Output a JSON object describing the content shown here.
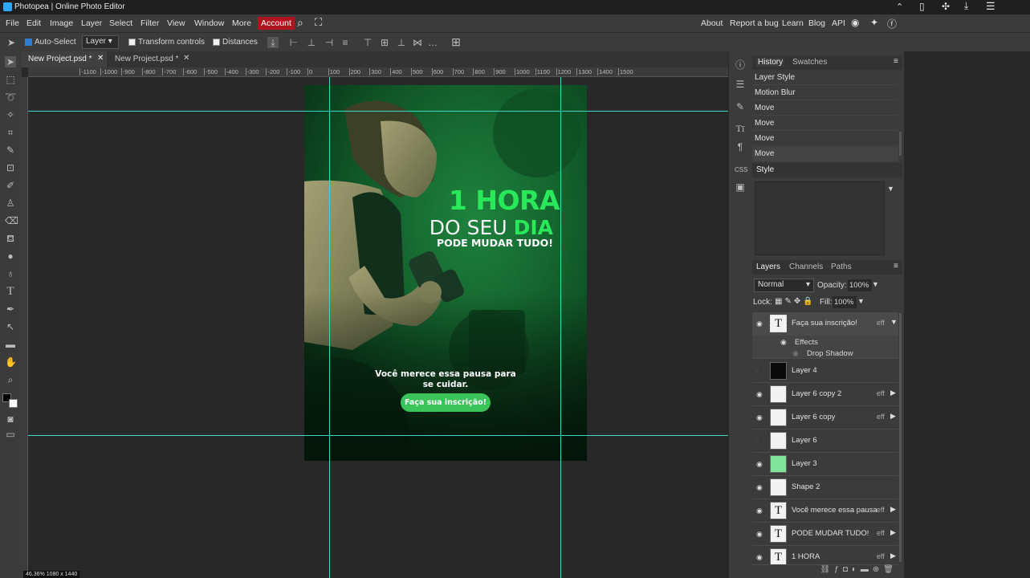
{
  "app": {
    "title": "Photopea | Online Photo Editor"
  },
  "menu": {
    "items": [
      "File",
      "Edit",
      "Image",
      "Layer",
      "Select",
      "Filter",
      "View",
      "Window",
      "More"
    ],
    "account": "Account",
    "right": [
      "About",
      "Report a bug",
      "Learn",
      "Blog",
      "API"
    ]
  },
  "options": {
    "auto_select": "Auto-Select",
    "layer_select": "Layer",
    "transform_controls": "Transform controls",
    "distances": "Distances"
  },
  "tabs": [
    {
      "label": "New Project.psd *",
      "active": true
    },
    {
      "label": "New Project.psd *",
      "active": false
    }
  ],
  "ruler": {
    "ticks": [
      "-1100",
      "-1000",
      "-900",
      "-800",
      "-700",
      "-600",
      "-500",
      "-400",
      "-300",
      "-200",
      "-100",
      "0",
      "100",
      "200",
      "300",
      "400",
      "500",
      "600",
      "700",
      "800",
      "900",
      "1000",
      "1100",
      "1200",
      "1300",
      "1400",
      "1500"
    ]
  },
  "poster": {
    "headline1": "1 HORA",
    "headline2a": "DO SEU ",
    "headline2b": "DIA",
    "headline3": "PODE MUDAR TUDO!",
    "body1": "Você merece essa pausa para",
    "body2": "se cuidar.",
    "cta": "Faça sua inscrição!",
    "accent": "#29e85a",
    "cta_color": "#3bc45a"
  },
  "history": {
    "tabs": [
      "History",
      "Swatches"
    ],
    "items": [
      "Layer Style",
      "Motion Blur",
      "Move",
      "Move",
      "Move",
      "Move"
    ]
  },
  "style": {
    "tab": "Style"
  },
  "layers_panel": {
    "tabs": [
      "Layers",
      "Channels",
      "Paths"
    ],
    "blend_mode": "Normal",
    "opacity_label": "Opacity:",
    "opacity_value": "100%",
    "lock_label": "Lock:",
    "fill_label": "Fill:",
    "fill_value": "100%",
    "effects_label": "Effects",
    "drop_shadow_label": "Drop Shadow",
    "eff": "eff",
    "layers": [
      {
        "name": "Faça sua inscrição!",
        "kind": "text",
        "visible": true,
        "fx": true,
        "selected": true
      },
      {
        "name": "Layer 4",
        "kind": "dark",
        "visible": false,
        "fx": false
      },
      {
        "name": "Layer 6 copy 2",
        "kind": "checker",
        "visible": true,
        "fx": true
      },
      {
        "name": "Layer 6 copy",
        "kind": "checker",
        "visible": true,
        "fx": true
      },
      {
        "name": "Layer 6",
        "kind": "checker",
        "visible": false,
        "fx": false
      },
      {
        "name": "Layer 3",
        "kind": "green",
        "visible": true,
        "fx": false
      },
      {
        "name": "Shape 2",
        "kind": "checker",
        "visible": true,
        "fx": false
      },
      {
        "name": "Você merece essa pausa",
        "kind": "text",
        "visible": true,
        "fx": true
      },
      {
        "name": "PODE MUDAR TUDO!",
        "kind": "text",
        "visible": true,
        "fx": true
      },
      {
        "name": "1 HORA",
        "kind": "text",
        "visible": true,
        "fx": true
      }
    ]
  },
  "status": {
    "zoom": "46.36%",
    "size": "1080 x 1440"
  }
}
